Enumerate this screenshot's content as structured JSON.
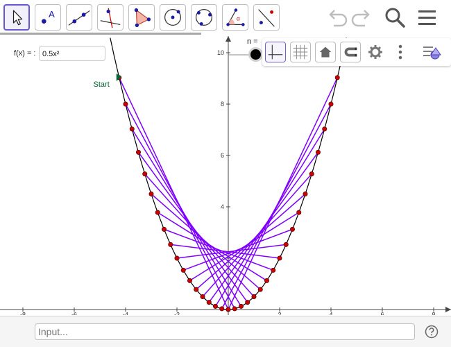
{
  "toolbar": {
    "tools": [
      {
        "name": "move-tool",
        "selected": true
      },
      {
        "name": "point-tool",
        "label": "A"
      },
      {
        "name": "line-tool"
      },
      {
        "name": "perpendicular-line-tool"
      },
      {
        "name": "polygon-tool"
      },
      {
        "name": "circle-center-point-tool"
      },
      {
        "name": "circle-three-points-tool"
      },
      {
        "name": "angle-tool",
        "label": "α"
      },
      {
        "name": "reflect-tool"
      }
    ],
    "right_icons": [
      "undo-icon",
      "redo-icon",
      "search-icon",
      "menu-icon"
    ]
  },
  "algebra": {
    "function_label": "f(x) = :",
    "function_value": "0.5x²"
  },
  "slider": {
    "label": "n ="
  },
  "graphics": {
    "start_label": "Start",
    "x_ticks": [
      "-8",
      "-6",
      "-4",
      "-2",
      "2",
      "4",
      "6",
      "8"
    ],
    "y_ticks": [
      "2",
      "4",
      "6",
      "8",
      "10"
    ],
    "function": "0.5x²",
    "colors": {
      "curve": "#000000",
      "segments": "#7f00ff",
      "points": "#cc0000",
      "start_marker": "#006633",
      "start_label": "#006633"
    }
  },
  "style_bar": {
    "buttons": [
      "axes-toggle-icon",
      "grid-toggle-icon",
      "home-icon",
      "magnet-icon",
      "settings-icon",
      "more-options-icon",
      "toggle-style-bar-icon"
    ]
  },
  "input_bar": {
    "placeholder": "Input...",
    "help_icon": "help-icon"
  }
}
